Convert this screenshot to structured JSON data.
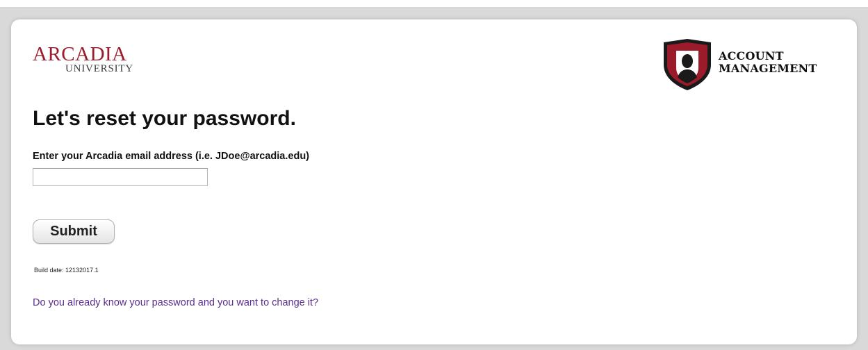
{
  "branding": {
    "university_name": "ARCADIA",
    "university_sub": "UNIVERSITY",
    "account_line1": "ACCOUNT",
    "account_line2": "MANAGEMENT",
    "brand_color": "#9b1b2a"
  },
  "page": {
    "heading": "Let's reset your password.",
    "email_label": "Enter your Arcadia email address (i.e. JDoe@arcadia.edu)",
    "email_value": "",
    "email_placeholder": "",
    "submit_label": "Submit",
    "build_text": "Build date: 12132017.1",
    "change_link": "Do you already know your password and you want to change it?",
    "link_color": "#5b2d8e"
  },
  "icons": {
    "shield": "shield-user-icon"
  }
}
